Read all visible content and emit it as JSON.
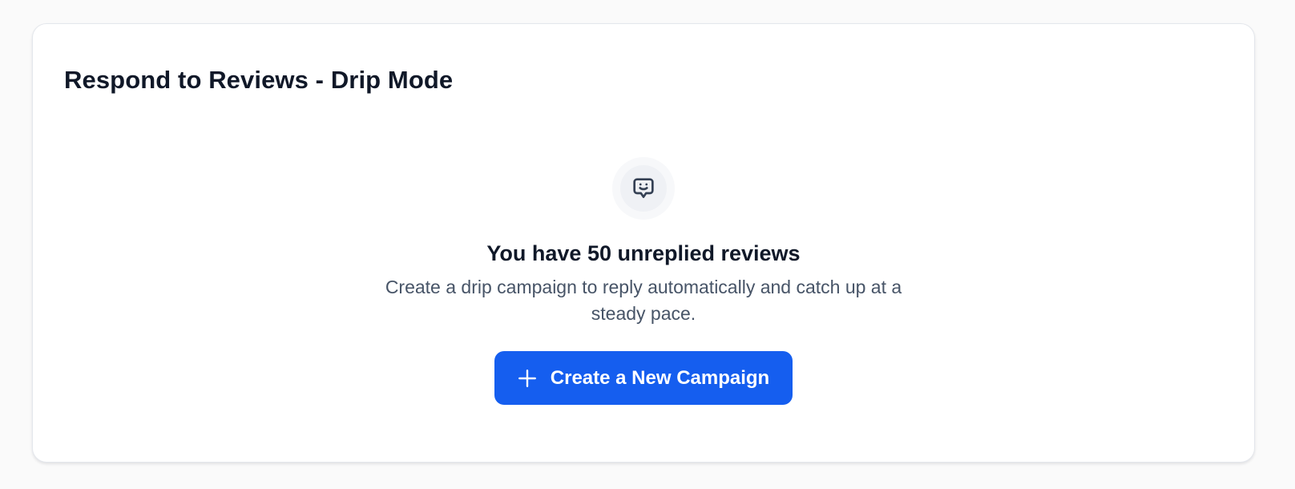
{
  "card": {
    "title": "Respond to Reviews - Drip Mode"
  },
  "empty_state": {
    "icon": "message-smile-icon",
    "heading": "You have 50 unreplied reviews",
    "description": "Create a drip campaign to reply automatically and catch up at a steady pace.",
    "button_icon": "plus-icon",
    "button_label": "Create a New Campaign"
  },
  "colors": {
    "page_background": "#fafafa",
    "card_background": "#ffffff",
    "heading_text": "#101828",
    "body_text": "#475467",
    "accent": "#155eef",
    "icon_stroke": "#344054"
  }
}
